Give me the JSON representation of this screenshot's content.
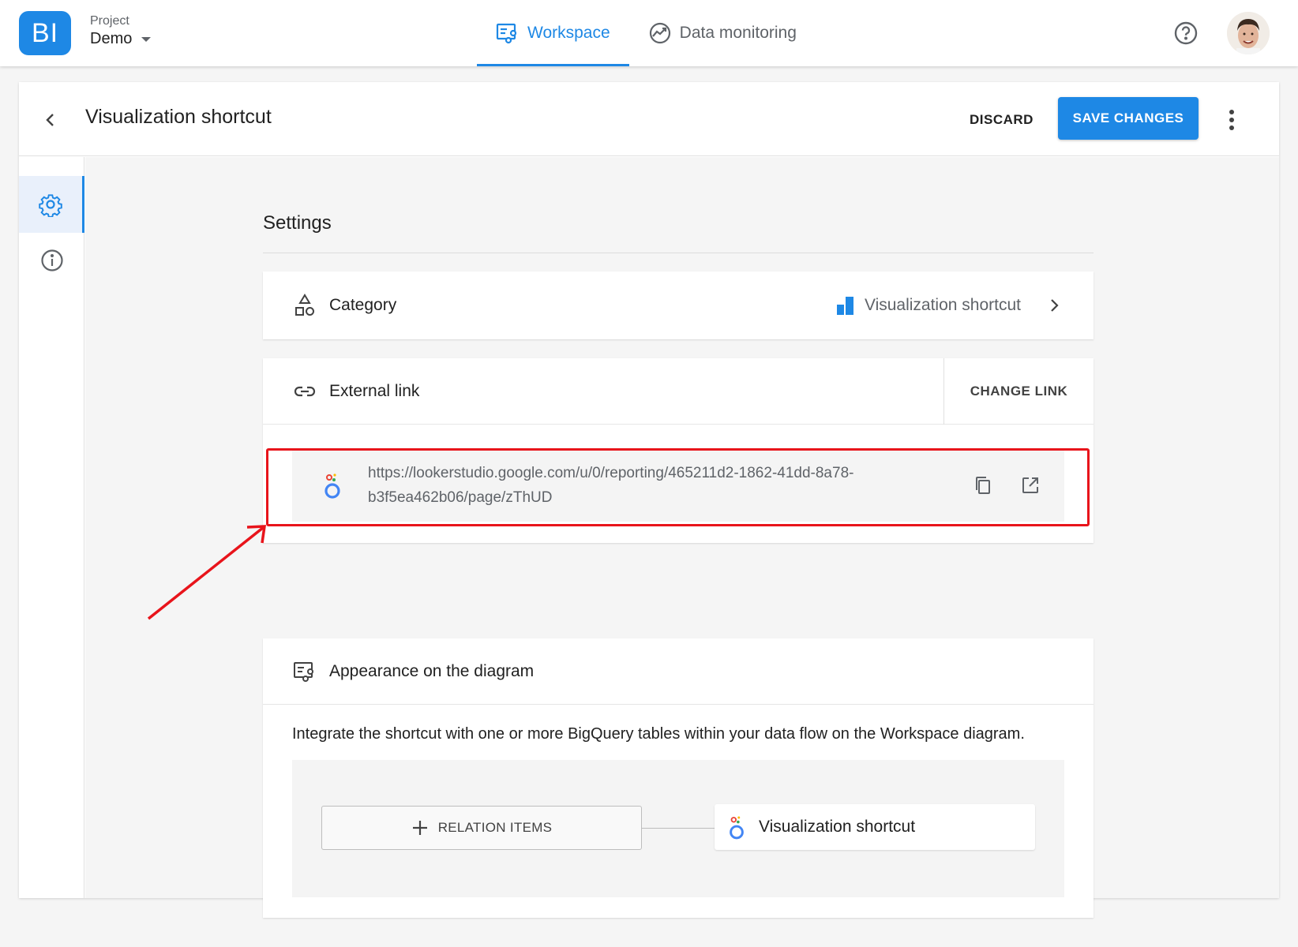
{
  "topbar": {
    "logo_text": "BI",
    "project_label": "Project",
    "project_name": "Demo",
    "tabs": [
      {
        "label": "Workspace",
        "icon": "workspace-icon",
        "active": true
      },
      {
        "label": "Data monitoring",
        "icon": "monitoring-icon",
        "active": false
      }
    ],
    "help_icon": "help-icon",
    "accent_color": "#1e88e5"
  },
  "header": {
    "title": "Visualization shortcut",
    "discard_label": "DISCARD",
    "save_label": "SAVE CHANGES"
  },
  "settings": {
    "title": "Settings",
    "category": {
      "label": "Category",
      "value": "Visualization shortcut"
    },
    "external_link": {
      "label": "External link",
      "change_label": "CHANGE LINK",
      "url": "https://lookerstudio.google.com/u/0/reporting/465211d2-1862-41dd-8a78-b3f5ea462b06/page/zThUD"
    },
    "appearance": {
      "label": "Appearance on the diagram",
      "description": "Integrate the shortcut with one or more BigQuery tables within your data flow on the Workspace diagram.",
      "relation_button": "RELATION ITEMS",
      "node_label": "Visualization shortcut"
    }
  },
  "annotation": {
    "highlight_color": "#e8141b"
  }
}
